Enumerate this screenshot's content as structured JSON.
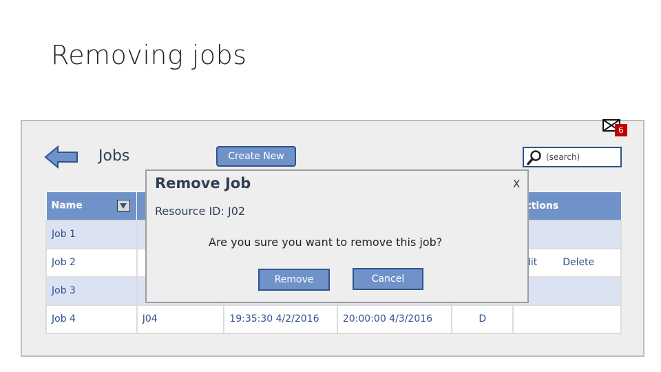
{
  "slide": {
    "title": "Removing jobs"
  },
  "header": {
    "heading": "Jobs",
    "create_label": "Create New",
    "search_placeholder": "(search)",
    "notification_count": "6"
  },
  "table": {
    "col_name": "Name",
    "col_actions": "Actions",
    "rows": [
      {
        "name": "Job 1"
      },
      {
        "name": "Job 2",
        "action_edit": "Edit",
        "action_delete": "Delete"
      },
      {
        "name": "Job 3"
      },
      {
        "name": "Job 4",
        "resource": "J04",
        "start": "19:35:30 4/2/2016",
        "end": "20:00:00 4/3/2016",
        "state": "D"
      }
    ]
  },
  "modal": {
    "title": "Remove Job",
    "close": "X",
    "resource_line": "Resource ID: J02",
    "question": "Are you sure you want to remove this job?",
    "remove_label": "Remove",
    "cancel_label": "Cancel"
  }
}
